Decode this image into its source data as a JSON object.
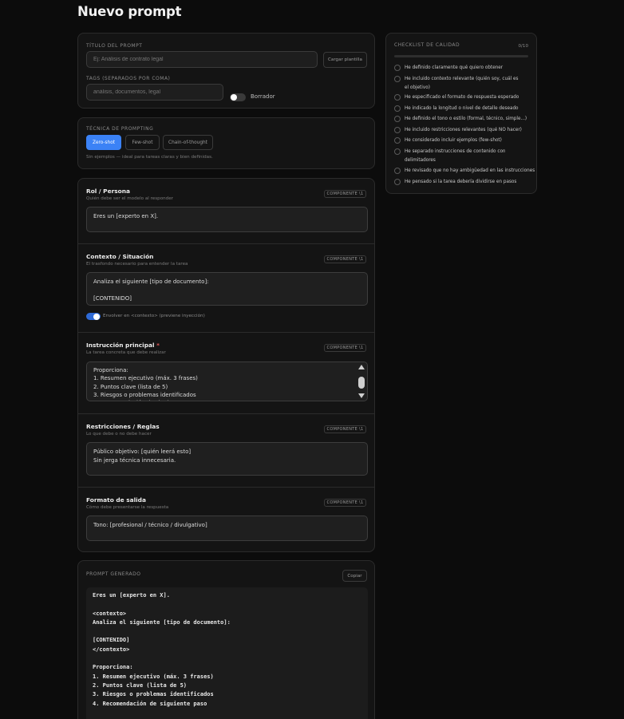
{
  "page": {
    "title": "Nuevo prompt"
  },
  "meta": {
    "title_label": "TÍTULO DEL PROMPT",
    "title_placeholder": "Ej: Análisis de contrato legal",
    "load_template_label": "Cargar plantilla",
    "tags_label": "TAGS (SEPARADOS POR COMA)",
    "tags_placeholder": "análisis, documentos, legal",
    "draft_label": "Borrador",
    "draft_on": false
  },
  "technique": {
    "label": "TÉCNICA DE PROMPTING",
    "options": [
      "Zero-shot",
      "Few-shot",
      "Chain-of-thought"
    ],
    "selected": "Zero-shot",
    "hint": "Sin ejemplos — ideal para tareas claras y bien definidas."
  },
  "components": {
    "badge_label": "COMPONENTE \\1",
    "role": {
      "title": "Rol / Persona",
      "subtitle": "Quién debe ser el modelo al responder",
      "value": "Eres un [experto en X]."
    },
    "context": {
      "title": "Contexto / Situación",
      "subtitle": "El trasfondo necesario para entender la tarea",
      "value": "Analiza el siguiente [tipo de documento]:\n\n[CONTENIDO]",
      "wrap_label": "Envolver en <contexto> (previene inyección)",
      "wrap_on": true
    },
    "instruction": {
      "title": "Instrucción principal",
      "required_mark": "*",
      "subtitle": "La tarea concreta que debe realizar",
      "value": "Proporciona:\n1. Resumen ejecutivo (máx. 3 frases)\n2. Puntos clave (lista de 5)\n3. Riesgos o problemas identificados\n4. Recomendación de siguiente paso"
    },
    "restrictions": {
      "title": "Restricciones / Reglas",
      "subtitle": "Lo que debe o no debe hacer",
      "value": "Público objetivo: [quién leerá esto]\nSin jerga técnica innecesaria."
    },
    "output": {
      "title": "Formato de salida",
      "subtitle": "Cómo debe presentarse la respuesta",
      "value": "Tono: [profesional / técnico / divulgativo]"
    }
  },
  "generated": {
    "label": "PROMPT GENERADO",
    "copy_label": "Copiar",
    "text": "Eres un [experto en X].\n\n<contexto>\nAnaliza el siguiente [tipo de documento]:\n\n[CONTENIDO]\n</contexto>\n\nProporciona:\n1. Resumen ejecutivo (máx. 3 frases)\n2. Puntos clave (lista de 5)\n3. Riesgos o problemas identificados\n4. Recomendación de siguiente paso"
  },
  "checklist": {
    "label": "CHECKLIST DE CALIDAD",
    "progress_text": "0/10",
    "progress": 0,
    "items": [
      "He definido claramente qué quiero obtener",
      "He incluido contexto relevante (quién soy, cuál es el objetivo)",
      "He especificado el formato de respuesta esperado",
      "He indicado la longitud o nivel de detalle deseado",
      "He definido el tono o estilo (formal, técnico, simple...)",
      "He incluido restricciones relevantes (qué NO hacer)",
      "He considerado incluir ejemplos (few-shot)",
      "He separado instrucciones de contenido con delimitadores",
      "He revisado que no hay ambigüedad en las instrucciones",
      "He pensado si la tarea debería dividirse en pasos"
    ]
  }
}
